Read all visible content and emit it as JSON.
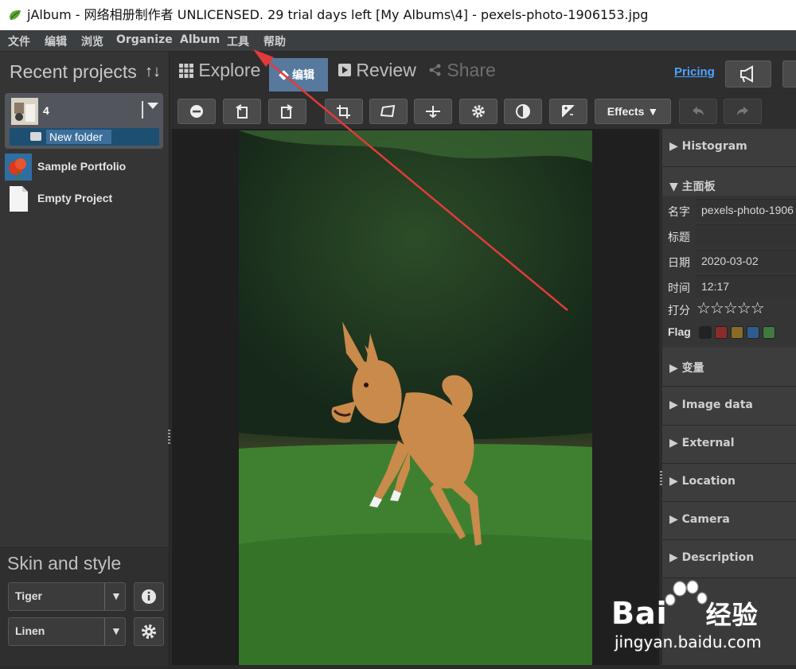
{
  "window": {
    "title": "jAlbum - 网络相册制作者 UNLICENSED. 29 trial days left [My Albums\\4] - pexels-photo-1906153.jpg"
  },
  "menu": [
    "文件",
    "编辑",
    "浏览",
    "Organize",
    "Album",
    "工具",
    "帮助"
  ],
  "left_panel": {
    "header": "Recent projects",
    "sort_icon": "↑↓",
    "current_project": {
      "name": "4",
      "folder": "New folder"
    },
    "projects": [
      {
        "name": "Sample Portfolio",
        "icon": "flower-thumbnail"
      },
      {
        "name": "Empty Project",
        "icon": "blank-page-icon"
      }
    ],
    "skin_header": "Skin and style",
    "skin_value": "Tiger",
    "style_value": "Linen"
  },
  "tabs": [
    {
      "label": "Explore",
      "icon": "grid-icon"
    },
    {
      "label": "编辑",
      "icon": "diamond-icon",
      "active": true
    },
    {
      "label": "Review",
      "icon": "play-icon"
    },
    {
      "label": "Share",
      "icon": "share-icon"
    }
  ],
  "pricing_link": "Pricing",
  "toolbar": {
    "effects_label": "Effects ▼",
    "buttons": [
      "minus-icon",
      "rotate-left-icon",
      "rotate-right-icon",
      "crop-icon",
      "transform-icon",
      "level-icon",
      "gear-icon",
      "contrast-icon",
      "exposure-icon",
      "undo-icon",
      "redo-icon"
    ]
  },
  "photo": {
    "filename": "pexels-photo-1906153.jpg",
    "subject": "dog-jumping-on-grass"
  },
  "right_panel": {
    "sections": {
      "histogram": "Histogram",
      "main": "主面板",
      "variables": "变量",
      "image_data": "Image data",
      "external": "External",
      "location": "Location",
      "camera": "Camera",
      "description": "Description"
    },
    "fields": {
      "name_label": "名字",
      "name_value": "pexels-photo-1906",
      "title_label": "标题",
      "title_value": "",
      "date_label": "日期",
      "date_value": "2020-03-02",
      "time_label": "时间",
      "time_value": "12:17",
      "rating_label": "打分",
      "rating_value": "☆☆☆☆☆",
      "flag_label": "Flag"
    },
    "flag_colors": [
      "#222222",
      "#8b2c2c",
      "#8a6a2a",
      "#2d5d8c",
      "#3f7a3f"
    ]
  },
  "watermark": {
    "brand": "Bai",
    "brand2": "经验",
    "url": "jingyan.baidu.com"
  }
}
